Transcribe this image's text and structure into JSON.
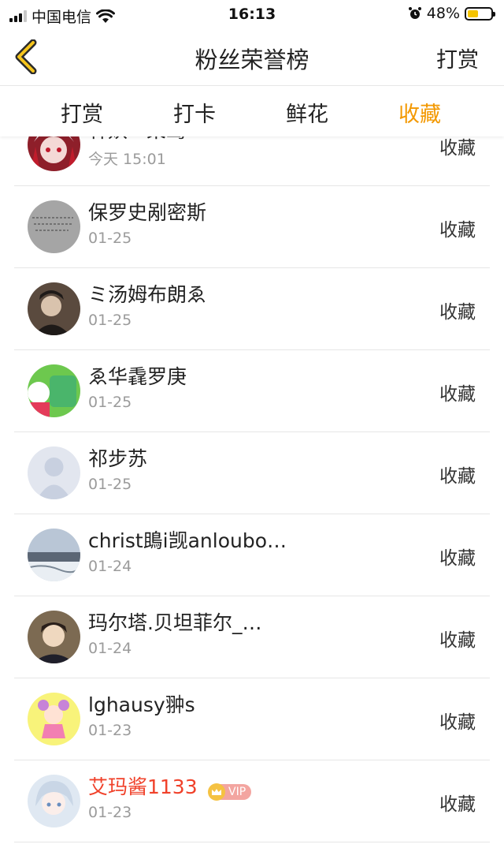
{
  "status_bar": {
    "carrier": "中国电信",
    "time": "16:13",
    "battery_text": "48%",
    "battery_level": 0.48,
    "icons": [
      "signal-icon",
      "wifi-icon",
      "alarm-icon",
      "battery-icon"
    ]
  },
  "nav": {
    "back_icon": "chevron-left-icon",
    "title": "粉丝荣誉榜",
    "right_action": "打赏"
  },
  "tabs": [
    {
      "label": "打赏",
      "active": false
    },
    {
      "label": "打卡",
      "active": false
    },
    {
      "label": "鲜花",
      "active": false
    },
    {
      "label": "收藏",
      "active": true
    }
  ],
  "colors": {
    "accent": "#f39800",
    "vip_name": "#f0412a",
    "battery": "#f5c400"
  },
  "fans": [
    {
      "name": "林妖 · 柒鸳",
      "date": "今天 15:01",
      "action": "收藏",
      "avatar": "anime-girl-avatar"
    },
    {
      "name": "保罗史剐密斯",
      "date": "01-25",
      "action": "收藏",
      "avatar": "handwriting-avatar"
    },
    {
      "name": "ミ汤姆布朗ゑ",
      "date": "01-25",
      "action": "收藏",
      "avatar": "man-portrait-avatar"
    },
    {
      "name": "ゑ华毳罗庚",
      "date": "01-25",
      "action": "收藏",
      "avatar": "green-poster-avatar"
    },
    {
      "name": "祁步苏",
      "date": "01-25",
      "action": "收藏",
      "avatar": "default-avatar"
    },
    {
      "name": "christ鴡i觊anloubo…",
      "date": "01-24",
      "action": "收藏",
      "avatar": "landscape-avatar"
    },
    {
      "name": "玛尔塔.贝坦菲尔_…",
      "date": "01-24",
      "action": "收藏",
      "avatar": "anime-boy-avatar"
    },
    {
      "name": "lghausy翀s",
      "date": "01-23",
      "action": "收藏",
      "avatar": "cartoon-girl-avatar"
    },
    {
      "name": "艾玛酱1133",
      "date": "01-23",
      "action": "收藏",
      "avatar": "anime-white-hair-avatar",
      "vip": true,
      "vip_label": "VIP"
    }
  ]
}
